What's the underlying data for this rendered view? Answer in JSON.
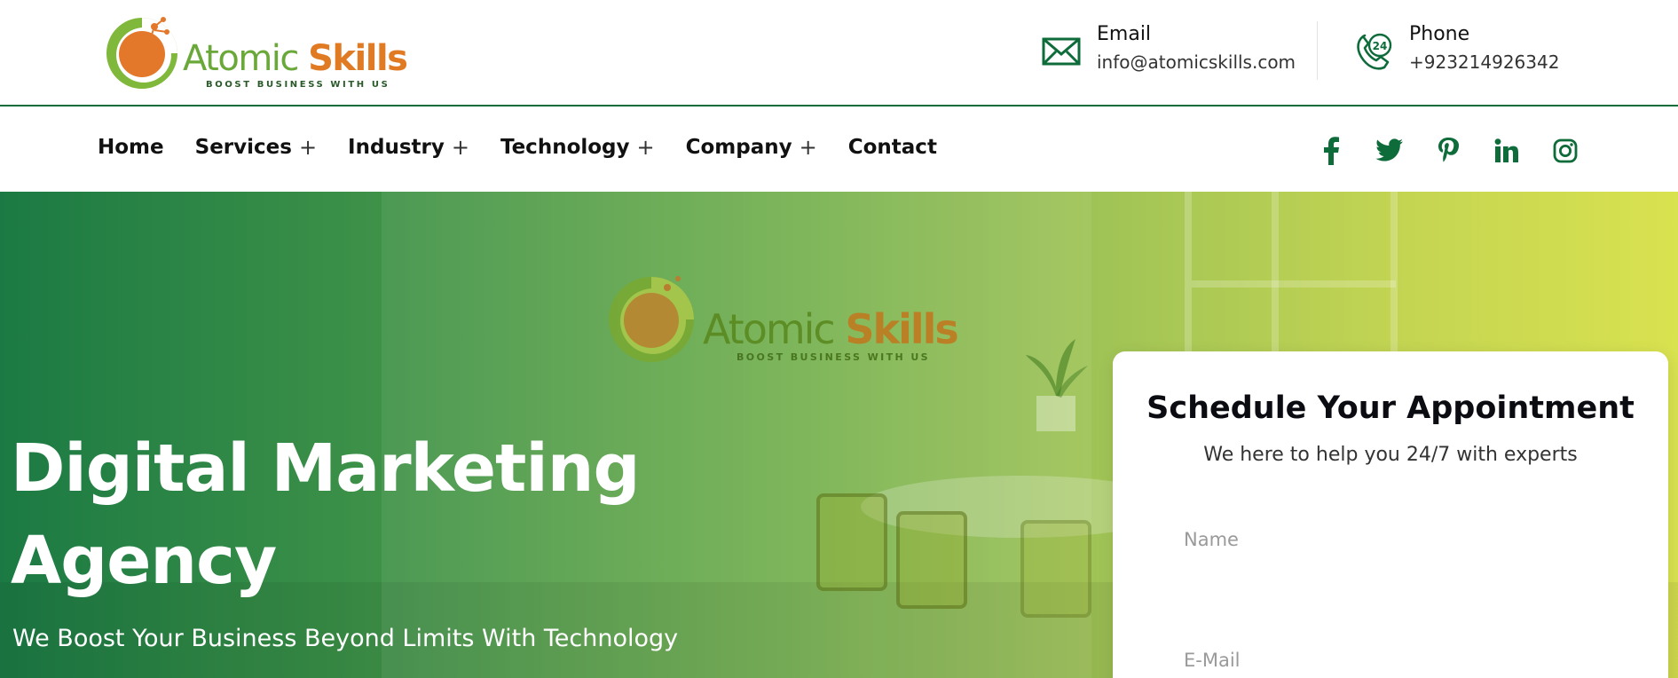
{
  "header": {
    "logo": {
      "word_primary": "Atomic ",
      "word_accent": "Skills",
      "tagline": "BOOST BUSINESS WITH US"
    },
    "email": {
      "label": "Email",
      "value": "info@atomicskills.com",
      "icon": "envelope-icon"
    },
    "phone": {
      "label": "Phone",
      "value": "+923214926342",
      "icon": "phone-24-icon"
    }
  },
  "nav": {
    "items": [
      {
        "label": "Home",
        "has_submenu": false
      },
      {
        "label": "Services",
        "has_submenu": true
      },
      {
        "label": "Industry",
        "has_submenu": true
      },
      {
        "label": "Technology",
        "has_submenu": true
      },
      {
        "label": "Company",
        "has_submenu": true
      },
      {
        "label": "Contact",
        "has_submenu": false
      }
    ],
    "submenu_glyph": "+",
    "social": [
      "facebook-icon",
      "twitter-icon",
      "pinterest-icon",
      "linkedin-icon",
      "instagram-icon"
    ]
  },
  "hero": {
    "title_line1": "Digital Marketing",
    "title_line2": "Agency",
    "subtitle": "We Boost Your Business Beyond Limits With Technology",
    "wall_logo": {
      "word_primary": "Atomic ",
      "word_accent": "Skills",
      "tagline": "BOOST BUSINESS WITH US"
    }
  },
  "form": {
    "title": "Schedule Your Appointment",
    "subtitle": "We here to help you 24/7 with experts",
    "name_placeholder": "Name",
    "email_placeholder": "E-Mail"
  },
  "colors": {
    "brand_green": "#0e6b3a",
    "logo_green": "#6aa83a",
    "logo_orange": "#e07b24",
    "hero_start": "#1b7a43",
    "hero_end": "#d9e24f"
  }
}
